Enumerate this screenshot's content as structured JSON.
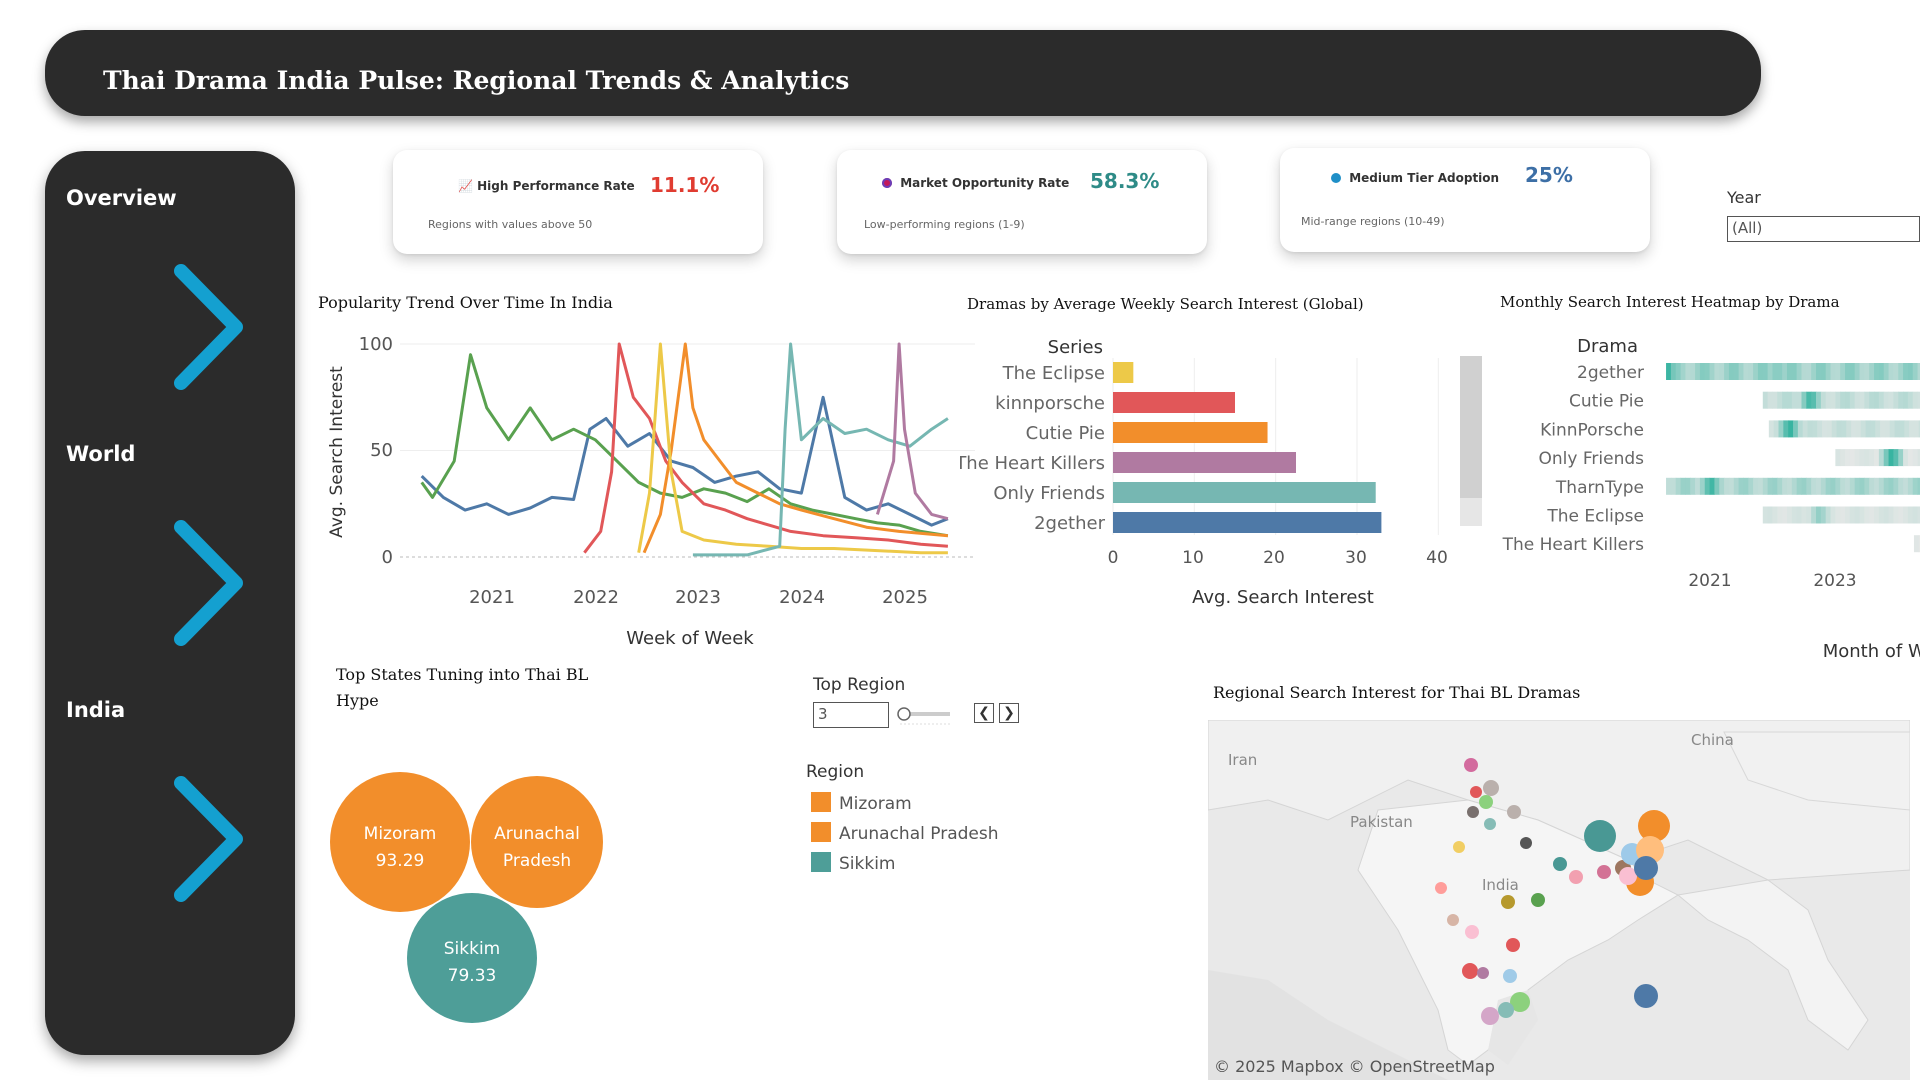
{
  "header": {
    "title": "Thai Drama India Pulse: Regional Trends & Analytics"
  },
  "sidebar": {
    "items": [
      {
        "label": "Overview"
      },
      {
        "label": "World"
      },
      {
        "label": "India"
      }
    ]
  },
  "kpis": [
    {
      "label": "High Performance Rate",
      "value": "11.1%",
      "sub": "Regions with values above 50",
      "icon": "chart-icon",
      "color": "#e03c31"
    },
    {
      "label": "Market Opportunity Rate",
      "value": "58.3%",
      "sub": "Low-performing regions (1-9)",
      "icon": "target-icon",
      "color": "#2e8b87"
    },
    {
      "label": "Medium Tier Adoption",
      "value": "25%",
      "sub": "Mid-range regions (10-49)",
      "icon": "globe-icon",
      "color": "#3d6fa6"
    }
  ],
  "filters": {
    "year": {
      "label": "Year",
      "value": "(All)"
    },
    "top_region": {
      "label": "Top Region",
      "value": "3"
    }
  },
  "trend_chart": {
    "title": "Popularity Trend Over Time In India",
    "ylabel": "Avg. Search Interest",
    "xlabel": "Week of Week",
    "y_ticks": [
      "100",
      "50",
      "0"
    ],
    "x_ticks": [
      "2021",
      "2022",
      "2023",
      "2024",
      "2025"
    ]
  },
  "bar_chart": {
    "title": "Dramas by Average Weekly Search Interest (Global)",
    "header": "Series",
    "xlabel": "Avg. Search Interest",
    "x_ticks": [
      "0",
      "10",
      "20",
      "30",
      "40"
    ]
  },
  "heatmap": {
    "title": "Monthly Search Interest Heatmap by Drama",
    "header": "Drama",
    "xlabel": "Month of Week",
    "rows": [
      "2gether",
      "Cutie Pie",
      "KinnPorsche",
      "Only Friends",
      "TharnType",
      "The Eclipse",
      "The Heart Killers"
    ],
    "x_ticks": [
      "2021",
      "2023"
    ]
  },
  "bubble_chart": {
    "title_line1": "Top States Tuning into Thai BL",
    "title_line2": "Hype",
    "legend_title": "Region",
    "legend": [
      {
        "name": "Mizoram",
        "color": "#f28e2b"
      },
      {
        "name": "Arunachal Pradesh",
        "color": "#f28e2b"
      },
      {
        "name": "Sikkim",
        "color": "#4e9e98"
      }
    ],
    "bubbles": [
      {
        "name": "Mizoram",
        "value": "93.29"
      },
      {
        "name_line1": "Arunachal",
        "name_line2": "Pradesh",
        "value": ""
      },
      {
        "name": "Sikkim",
        "value": "79.33"
      }
    ]
  },
  "map": {
    "title": "Regional Search Interest for Thai BL Dramas",
    "labels": {
      "iran": "Iran",
      "china": "China",
      "pakistan": "Pakistan",
      "india": "India"
    },
    "attribution": "© 2025 Mapbox  © OpenStreetMap"
  },
  "chart_data": [
    {
      "type": "line",
      "title": "Popularity Trend Over Time In India",
      "xlabel": "Week of Week",
      "ylabel": "Avg. Search Interest",
      "ylim": [
        0,
        100
      ],
      "xlim": [
        2020.4,
        2025.7
      ],
      "series": [
        {
          "color": "#4e79a7",
          "points": [
            [
              2020.6,
              38
            ],
            [
              2020.8,
              28
            ],
            [
              2021.0,
              22
            ],
            [
              2021.2,
              25
            ],
            [
              2021.4,
              20
            ],
            [
              2021.6,
              23
            ],
            [
              2021.8,
              28
            ],
            [
              2022.0,
              27
            ],
            [
              2022.15,
              60
            ],
            [
              2022.3,
              65
            ],
            [
              2022.5,
              52
            ],
            [
              2022.7,
              58
            ],
            [
              2022.9,
              45
            ],
            [
              2023.1,
              42
            ],
            [
              2023.3,
              35
            ],
            [
              2023.5,
              38
            ],
            [
              2023.7,
              40
            ],
            [
              2023.9,
              32
            ],
            [
              2024.1,
              30
            ],
            [
              2024.3,
              75
            ],
            [
              2024.5,
              28
            ],
            [
              2024.7,
              22
            ],
            [
              2024.9,
              25
            ],
            [
              2025.1,
              20
            ],
            [
              2025.3,
              15
            ],
            [
              2025.45,
              18
            ]
          ]
        },
        {
          "color": "#59a14f",
          "points": [
            [
              2020.6,
              35
            ],
            [
              2020.7,
              28
            ],
            [
              2020.9,
              45
            ],
            [
              2021.05,
              95
            ],
            [
              2021.2,
              70
            ],
            [
              2021.4,
              55
            ],
            [
              2021.6,
              70
            ],
            [
              2021.8,
              55
            ],
            [
              2022.0,
              60
            ],
            [
              2022.2,
              55
            ],
            [
              2022.4,
              45
            ],
            [
              2022.6,
              35
            ],
            [
              2022.8,
              30
            ],
            [
              2023.0,
              28
            ],
            [
              2023.2,
              32
            ],
            [
              2023.4,
              30
            ],
            [
              2023.6,
              26
            ],
            [
              2023.8,
              32
            ],
            [
              2024.0,
              25
            ],
            [
              2024.2,
              22
            ],
            [
              2024.4,
              20
            ],
            [
              2024.6,
              18
            ],
            [
              2024.8,
              16
            ],
            [
              2025.0,
              15
            ],
            [
              2025.2,
              12
            ],
            [
              2025.45,
              10
            ]
          ]
        },
        {
          "color": "#e15759",
          "points": [
            [
              2022.1,
              2
            ],
            [
              2022.25,
              12
            ],
            [
              2022.35,
              40
            ],
            [
              2022.42,
              100
            ],
            [
              2022.55,
              75
            ],
            [
              2022.7,
              65
            ],
            [
              2022.85,
              45
            ],
            [
              2023.0,
              35
            ],
            [
              2023.2,
              25
            ],
            [
              2023.4,
              22
            ],
            [
              2023.6,
              18
            ],
            [
              2023.8,
              15
            ],
            [
              2024.0,
              12
            ],
            [
              2024.3,
              10
            ],
            [
              2024.6,
              9
            ],
            [
              2024.9,
              8
            ],
            [
              2025.2,
              6
            ],
            [
              2025.45,
              5
            ]
          ]
        },
        {
          "color": "#f28e2b",
          "points": [
            [
              2022.65,
              2
            ],
            [
              2022.8,
              20
            ],
            [
              2022.9,
              50
            ],
            [
              2023.03,
              100
            ],
            [
              2023.1,
              70
            ],
            [
              2023.2,
              55
            ],
            [
              2023.35,
              45
            ],
            [
              2023.5,
              35
            ],
            [
              2023.7,
              30
            ],
            [
              2023.9,
              25
            ],
            [
              2024.1,
              22
            ],
            [
              2024.4,
              18
            ],
            [
              2024.7,
              14
            ],
            [
              2025.0,
              12
            ],
            [
              2025.45,
              10
            ]
          ]
        },
        {
          "color": "#edc948",
          "points": [
            [
              2022.6,
              2
            ],
            [
              2022.7,
              30
            ],
            [
              2022.8,
              100
            ],
            [
              2022.9,
              40
            ],
            [
              2023.0,
              12
            ],
            [
              2023.2,
              8
            ],
            [
              2023.5,
              6
            ],
            [
              2023.8,
              5
            ],
            [
              2024.1,
              4
            ],
            [
              2024.4,
              4
            ],
            [
              2024.8,
              3
            ],
            [
              2025.2,
              2
            ],
            [
              2025.45,
              2
            ]
          ]
        },
        {
          "color": "#76b7b2",
          "points": [
            [
              2023.1,
              1
            ],
            [
              2023.6,
              1
            ],
            [
              2023.9,
              5
            ],
            [
              2023.95,
              60
            ],
            [
              2024.0,
              100
            ],
            [
              2024.1,
              55
            ],
            [
              2024.3,
              65
            ],
            [
              2024.5,
              58
            ],
            [
              2024.7,
              60
            ],
            [
              2024.9,
              55
            ],
            [
              2025.1,
              52
            ],
            [
              2025.3,
              60
            ],
            [
              2025.45,
              65
            ]
          ]
        },
        {
          "color": "#b07aa1",
          "points": [
            [
              2024.8,
              20
            ],
            [
              2024.95,
              45
            ],
            [
              2025.0,
              100
            ],
            [
              2025.05,
              60
            ],
            [
              2025.15,
              30
            ],
            [
              2025.3,
              20
            ],
            [
              2025.45,
              18
            ]
          ]
        }
      ]
    },
    {
      "type": "bar",
      "title": "Dramas by Average Weekly Search Interest (Global)",
      "xlabel": "Avg. Search Interest",
      "categories": [
        "The Eclipse",
        "kinnporsche",
        "Cutie Pie",
        "The Heart Killers",
        "Only Friends",
        "2gether"
      ],
      "values": [
        2.5,
        15,
        19,
        22.5,
        32.3,
        33
      ],
      "colors": [
        "#edc948",
        "#e15759",
        "#f28e2b",
        "#b07aa1",
        "#76b7b2",
        "#4e79a7"
      ],
      "xlim": [
        0,
        45
      ]
    },
    {
      "type": "heatmap",
      "title": "Monthly Search Interest Heatmap by Drama",
      "xlabel": "Month of Week",
      "rows": [
        "2gether",
        "Cutie Pie",
        "KinnPorsche",
        "Only Friends",
        "TharnType",
        "The Eclipse",
        "The Heart Killers"
      ],
      "xlim": [
        2020.2,
        2024.5
      ],
      "spans": [
        {
          "row": 0,
          "start": 2020.3,
          "end": 2024.5,
          "intensity": 0.55,
          "peaks": [
            [
              2020.3,
              0.9
            ],
            [
              2022.1,
              0.6
            ]
          ]
        },
        {
          "row": 1,
          "start": 2021.9,
          "end": 2024.5,
          "intensity": 0.3,
          "peaks": [
            [
              2022.65,
              0.95
            ]
          ]
        },
        {
          "row": 2,
          "start": 2022.0,
          "end": 2024.5,
          "intensity": 0.25,
          "peaks": [
            [
              2022.3,
              1.0
            ]
          ]
        },
        {
          "row": 3,
          "start": 2023.1,
          "end": 2024.5,
          "intensity": 0.12,
          "peaks": [
            [
              2024.0,
              1.0
            ]
          ]
        },
        {
          "row": 4,
          "start": 2020.3,
          "end": 2024.5,
          "intensity": 0.45,
          "peaks": [
            [
              2021.0,
              0.95
            ]
          ]
        },
        {
          "row": 5,
          "start": 2021.9,
          "end": 2024.5,
          "intensity": 0.15,
          "peaks": [
            [
              2022.8,
              0.5
            ]
          ]
        },
        {
          "row": 6,
          "start": 2024.4,
          "end": 2024.5,
          "intensity": 0.1,
          "peaks": []
        }
      ]
    },
    {
      "type": "bubble",
      "title": "Top States Tuning into Thai BL Hype",
      "categories": [
        "Mizoram",
        "Arunachal Pradesh",
        "Sikkim"
      ],
      "values": [
        93.29,
        90,
        79.33
      ],
      "colors": [
        "#f28e2b",
        "#f28e2b",
        "#4e9e98"
      ]
    }
  ]
}
